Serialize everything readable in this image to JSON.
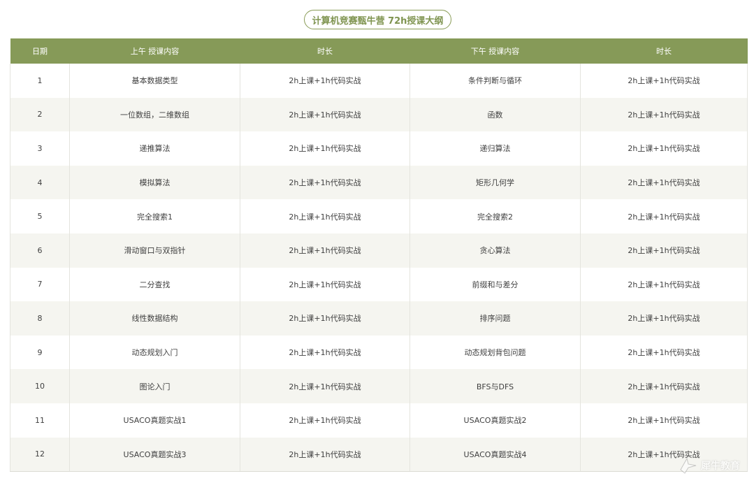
{
  "title": "计算机竞赛甄牛营 72h授课大纲",
  "headers": [
    "日期",
    "上午 授课内容",
    "时长",
    "下午 授课内容",
    "时长"
  ],
  "rows": [
    {
      "day": "1",
      "am": "基本数据类型",
      "am_time": "2h上课+1h代码实战",
      "pm": "条件判断与循环",
      "pm_time": "2h上课+1h代码实战"
    },
    {
      "day": "2",
      "am": "一位数组，二维数组",
      "am_time": "2h上课+1h代码实战",
      "pm": "函数",
      "pm_time": "2h上课+1h代码实战"
    },
    {
      "day": "3",
      "am": "递推算法",
      "am_time": "2h上课+1h代码实战",
      "pm": "递归算法",
      "pm_time": "2h上课+1h代码实战"
    },
    {
      "day": "4",
      "am": "模拟算法",
      "am_time": "2h上课+1h代码实战",
      "pm": "矩形几何学",
      "pm_time": "2h上课+1h代码实战"
    },
    {
      "day": "5",
      "am": "完全搜索1",
      "am_time": "2h上课+1h代码实战",
      "pm": "完全搜索2",
      "pm_time": "2h上课+1h代码实战"
    },
    {
      "day": "6",
      "am": "滑动窗口与双指针",
      "am_time": "2h上课+1h代码实战",
      "pm": "贪心算法",
      "pm_time": "2h上课+1h代码实战"
    },
    {
      "day": "7",
      "am": "二分查找",
      "am_time": "2h上课+1h代码实战",
      "pm": "前缀和与差分",
      "pm_time": "2h上课+1h代码实战"
    },
    {
      "day": "8",
      "am": "线性数据结构",
      "am_time": "2h上课+1h代码实战",
      "pm": "排序问题",
      "pm_time": "2h上课+1h代码实战"
    },
    {
      "day": "9",
      "am": "动态规划入门",
      "am_time": "2h上课+1h代码实战",
      "pm": "动态规划背包问题",
      "pm_time": "2h上课+1h代码实战"
    },
    {
      "day": "10",
      "am": "图论入门",
      "am_time": "2h上课+1h代码实战",
      "pm": "BFS与DFS",
      "pm_time": "2h上课+1h代码实战"
    },
    {
      "day": "11",
      "am": "USACO真题实战1",
      "am_time": "2h上课+1h代码实战",
      "pm": "USACO真题实战2",
      "pm_time": "2h上课+1h代码实战"
    },
    {
      "day": "12",
      "am": "USACO真题实战3",
      "am_time": "2h上课+1h代码实战",
      "pm": "USACO真题实战4",
      "pm_time": "2h上课+1h代码实战"
    }
  ],
  "watermark": "犀牛教育",
  "colors": {
    "accent": "#869a58",
    "title_text": "#7f9450",
    "row_alt": "#f5f5f0"
  }
}
